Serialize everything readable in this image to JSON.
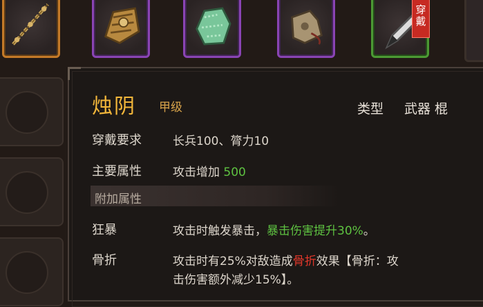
{
  "inventory": {
    "slots": [
      {
        "rarity": "orange",
        "icon": "staff-icon"
      },
      {
        "rarity": "purple",
        "icon": "scroll-armor-icon"
      },
      {
        "rarity": "purple",
        "icon": "jade-stone-icon"
      },
      {
        "rarity": "purple",
        "icon": "boots-icon"
      },
      {
        "rarity": "green",
        "icon": "blade-icon",
        "badge": "穿戴"
      }
    ]
  },
  "tooltip": {
    "name": "烛阴",
    "grade": "甲级",
    "type_label": "类型",
    "type_value": "武器 棍",
    "requirement": {
      "label": "穿戴要求",
      "value": "长兵100、膂力10"
    },
    "main_attribute": {
      "label": "主要属性",
      "prefix": "攻击增加 ",
      "value": "500"
    },
    "extra_section": "附加属性",
    "traits": [
      {
        "label": "狂暴",
        "text1": "攻击时触发暴击，",
        "highlight": "暴击伤害提升30%",
        "text2": "。"
      },
      {
        "label": "骨折",
        "text1": "攻击时有25%对敌造成",
        "highlight": "骨折",
        "text2": "效果【骨折：攻",
        "line2": "击伤害额外减少15%】。"
      }
    ]
  },
  "colors": {
    "name": "#f2b63a",
    "green_text": "#5ec241",
    "red_text": "#e2372a"
  }
}
